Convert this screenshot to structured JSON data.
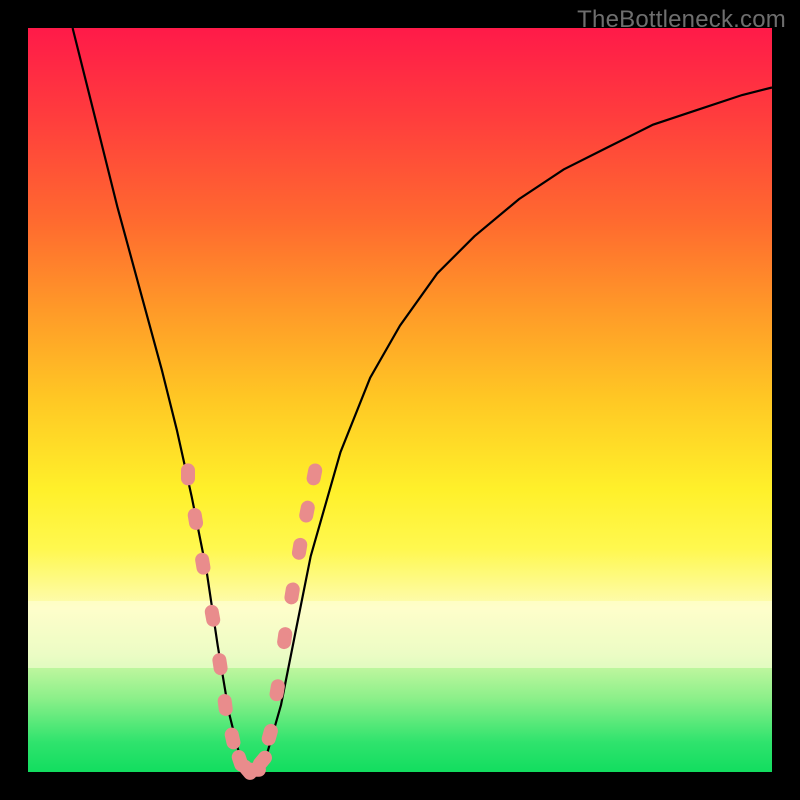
{
  "watermark": "TheBottleneck.com",
  "chart_data": {
    "type": "line",
    "title": "",
    "xlabel": "",
    "ylabel": "",
    "xlim": [
      0,
      100
    ],
    "ylim": [
      0,
      100
    ],
    "series": [
      {
        "name": "bottleneck-curve",
        "x": [
          6,
          9,
          12,
          15,
          18,
          20,
          22,
          24,
          25.5,
          27,
          28.5,
          30,
          32,
          34,
          36,
          38,
          42,
          46,
          50,
          55,
          60,
          66,
          72,
          78,
          84,
          90,
          96,
          100
        ],
        "values": [
          100,
          88,
          76,
          65,
          54,
          46,
          37,
          27,
          17,
          8,
          2,
          0,
          2,
          9,
          19,
          29,
          43,
          53,
          60,
          67,
          72,
          77,
          81,
          84,
          87,
          89,
          91,
          92
        ]
      }
    ],
    "markers": {
      "name": "highlight-dots",
      "color": "#e98c8c",
      "shape": "rounded-rect",
      "x": [
        21.5,
        22.5,
        23.5,
        24.8,
        25.8,
        26.5,
        27.5,
        28.5,
        29.5,
        30.5,
        31.5,
        32.5,
        33.5,
        34.5,
        35.5,
        36.5,
        37.5,
        38.5
      ],
      "values": [
        40,
        34,
        28,
        21,
        14.5,
        9,
        4.5,
        1.5,
        0.3,
        0.3,
        1.5,
        5,
        11,
        18,
        24,
        30,
        35,
        40
      ]
    },
    "gradient_stops": [
      {
        "pct": 0,
        "color": "#ff1a49"
      },
      {
        "pct": 50,
        "color": "#ffe028"
      },
      {
        "pct": 100,
        "color": "#12dd5f"
      }
    ]
  }
}
